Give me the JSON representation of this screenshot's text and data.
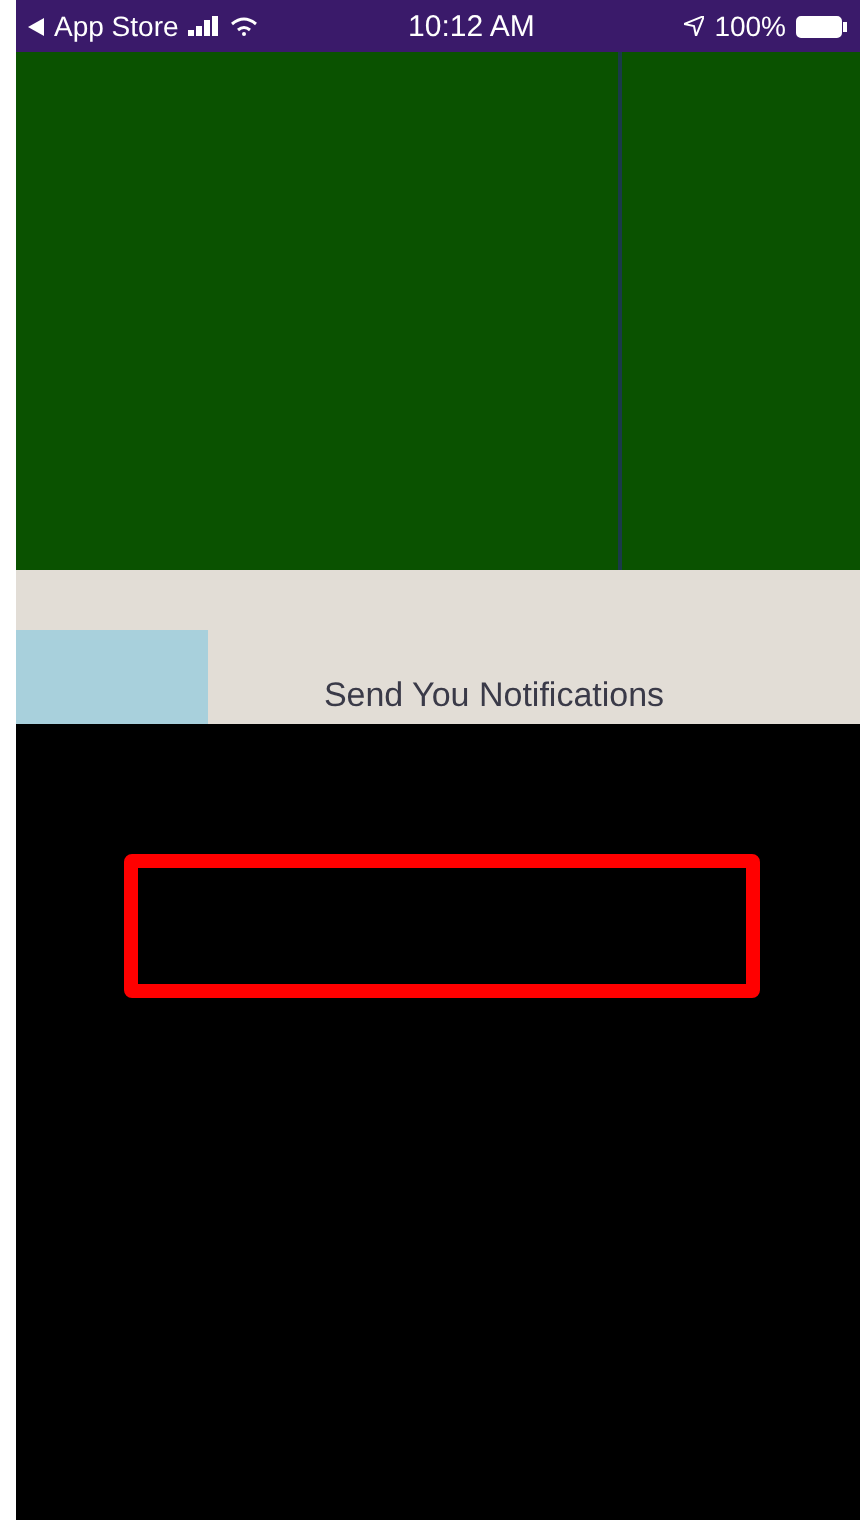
{
  "status_bar": {
    "back_label": "App Store",
    "time": "10:12 AM",
    "battery": "100%"
  },
  "alert": {
    "title": "Send You Notifications"
  }
}
